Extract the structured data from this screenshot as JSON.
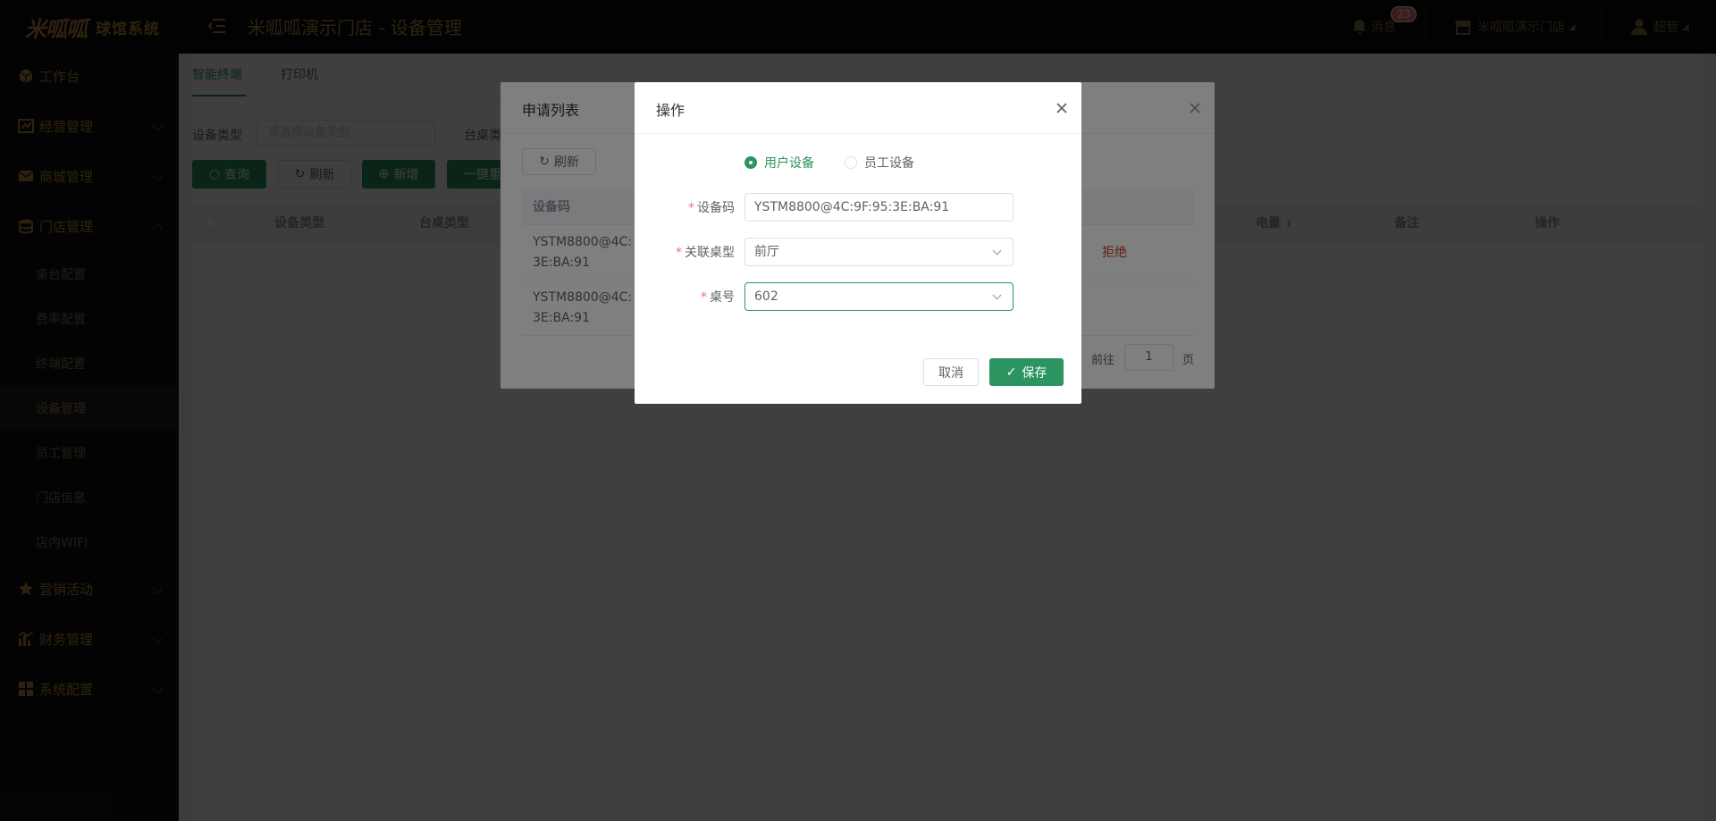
{
  "header": {
    "logo_mark": "米呱呱",
    "logo_text": "球馆系统",
    "title": "米呱呱演示门店 - 设备管理",
    "messages_label": "消息",
    "messages_count": "23",
    "store_name": "米呱呱演示门店",
    "user_name": "超管"
  },
  "sidebar": {
    "items": [
      {
        "label": "工作台"
      },
      {
        "label": "经营管理"
      },
      {
        "label": "商城管理"
      },
      {
        "label": "门店管理"
      },
      {
        "label": "营销活动"
      },
      {
        "label": "财务管理"
      },
      {
        "label": "系统配置"
      }
    ],
    "store_sub": [
      {
        "label": "桌台配置"
      },
      {
        "label": "费率配置"
      },
      {
        "label": "终端配置"
      },
      {
        "label": "设备管理"
      },
      {
        "label": "员工管理"
      },
      {
        "label": "门店信息"
      },
      {
        "label": "店内WIFI"
      }
    ]
  },
  "main": {
    "tabs": [
      "智能终端",
      "打印机"
    ],
    "filter": {
      "device_type_label": "设备类型",
      "device_type_placeholder": "请选择设备类型",
      "table_type_label": "台桌类"
    },
    "buttons": {
      "query": "查询",
      "refresh": "刷新",
      "add": "新增",
      "oneclick": "一键重"
    },
    "columns": [
      "设备类型",
      "台桌类型",
      "电量",
      "备注",
      "操作"
    ]
  },
  "apply_dialog": {
    "title": "申请列表",
    "refresh": "刷新",
    "col_code": "设备码",
    "rows": [
      {
        "code_line1": "YSTM8800@4C:",
        "code_line2": "3E:BA:91",
        "status": "拒绝"
      },
      {
        "code_line1": "YSTM8800@4C:",
        "code_line2": "3E:BA:91"
      }
    ],
    "pager_goto": "前往",
    "pager_page": "1",
    "pager_unit": "页"
  },
  "op_dialog": {
    "title": "操作",
    "radio_user": "用户设备",
    "radio_staff": "员工设备",
    "label_code": "设备码",
    "value_code": "YSTM8800@4C:9F:95:3E:BA:91",
    "label_type": "关联桌型",
    "value_type": "前厅",
    "label_table": "桌号",
    "value_table": "602",
    "cancel": "取消",
    "save": "保存"
  },
  "colors": {
    "accent": "#2b9460",
    "brand_gold": "#b8893e",
    "danger": "#f56c6c"
  }
}
